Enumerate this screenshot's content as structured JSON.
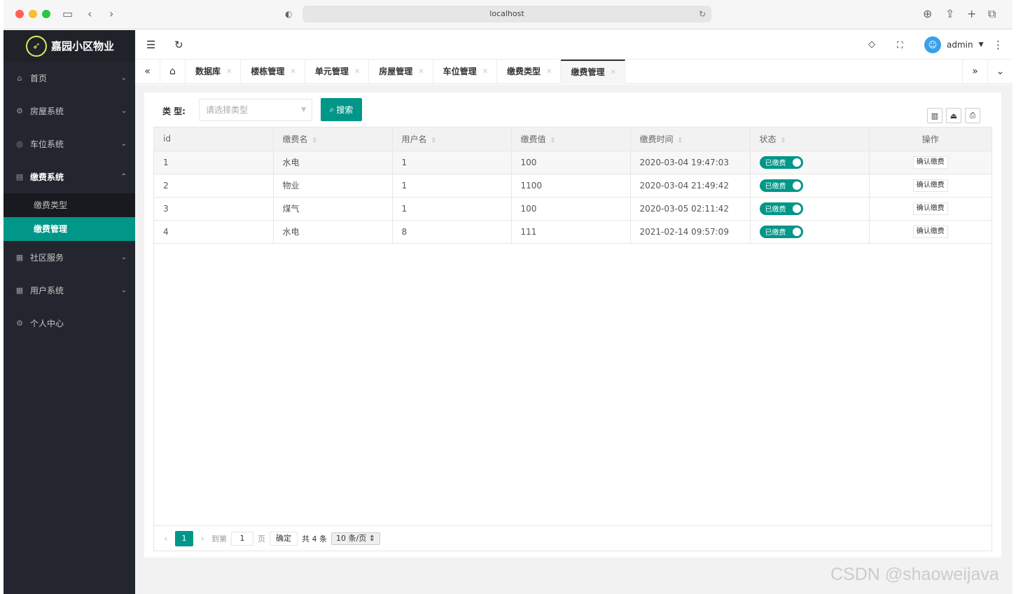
{
  "browser": {
    "url": "localhost",
    "icons": [
      "sidebar-icon",
      "back-icon",
      "forward-icon",
      "shield-icon",
      "reload-icon",
      "download-icon",
      "share-icon",
      "new-tab-icon",
      "tabs-icon"
    ]
  },
  "app": {
    "title": "嘉园小区物业",
    "accent": "#009688"
  },
  "sidebar": {
    "items": [
      {
        "label": "首页",
        "icon": "home-icon",
        "arrow": "⌄"
      },
      {
        "label": "房屋系统",
        "icon": "gear-icon",
        "arrow": "⌄"
      },
      {
        "label": "车位系统",
        "icon": "circle-icon",
        "arrow": "⌄"
      },
      {
        "label": "缴费系统",
        "icon": "file-icon",
        "arrow": "⌃"
      },
      {
        "label": "社区服务",
        "icon": "app-icon",
        "arrow": "⌄"
      },
      {
        "label": "用户系统",
        "icon": "app-icon",
        "arrow": "⌄"
      },
      {
        "label": "个人中心",
        "icon": "gear-icon",
        "arrow": ""
      }
    ],
    "sub_items": [
      {
        "label": "缴费类型"
      },
      {
        "label": "缴费管理"
      }
    ]
  },
  "header": {
    "user": "admin"
  },
  "tabs": [
    {
      "label": "数据库"
    },
    {
      "label": "楼栋管理"
    },
    {
      "label": "单元管理"
    },
    {
      "label": "房屋管理"
    },
    {
      "label": "车位管理"
    },
    {
      "label": "缴费类型"
    },
    {
      "label": "缴费管理"
    }
  ],
  "filter": {
    "label": "类 型:",
    "placeholder": "请选择类型",
    "search_label": "搜索"
  },
  "table": {
    "columns": [
      "id",
      "缴费名",
      "用户名",
      "缴费值",
      "缴费时间",
      "状态",
      "操作"
    ],
    "rows": [
      {
        "id": "1",
        "name": "水电",
        "user": "1",
        "value": "100",
        "time": "2020-03-04 19:47:03",
        "status": "已缴费",
        "action": "确认缴费"
      },
      {
        "id": "2",
        "name": "物业",
        "user": "1",
        "value": "1100",
        "time": "2020-03-04 21:49:42",
        "status": "已缴费",
        "action": "确认缴费"
      },
      {
        "id": "3",
        "name": "煤气",
        "user": "1",
        "value": "100",
        "time": "2020-03-05 02:11:42",
        "status": "已缴费",
        "action": "确认缴费"
      },
      {
        "id": "4",
        "name": "水电",
        "user": "8",
        "value": "111",
        "time": "2021-02-14 09:57:09",
        "status": "已缴费",
        "action": "确认缴费"
      }
    ]
  },
  "pager": {
    "current": "1",
    "goto_label": "到第",
    "goto_value": "1",
    "page_unit": "页",
    "confirm": "确定",
    "total": "共 4 条",
    "page_size": "10 条/页"
  },
  "watermark": "CSDN @shaoweijava"
}
